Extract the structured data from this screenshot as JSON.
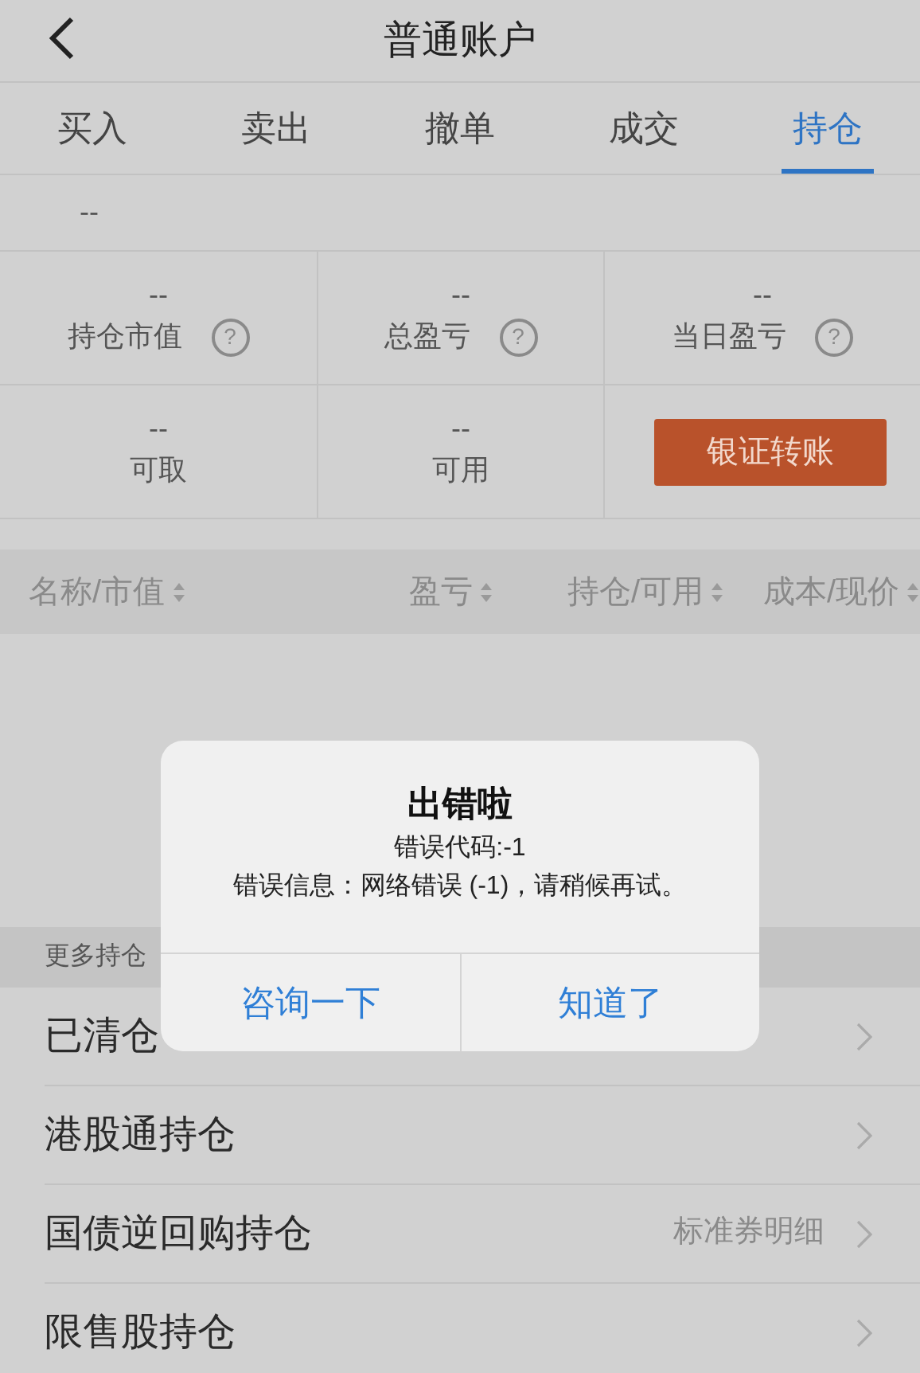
{
  "header": {
    "title": "普通账户"
  },
  "tabs": [
    {
      "label": "买入",
      "selected": false
    },
    {
      "label": "卖出",
      "selected": false
    },
    {
      "label": "撤单",
      "selected": false
    },
    {
      "label": "成交",
      "selected": false
    },
    {
      "label": "持仓",
      "selected": true
    }
  ],
  "account": {
    "value": "--"
  },
  "summary": [
    {
      "value": "--",
      "label": "持仓市值",
      "help": "?"
    },
    {
      "value": "--",
      "label": "总盈亏",
      "help": "?"
    },
    {
      "value": "--",
      "label": "当日盈亏",
      "help": "?"
    }
  ],
  "funds": [
    {
      "value": "--",
      "label": "可取"
    },
    {
      "value": "--",
      "label": "可用"
    }
  ],
  "transfer_button": "银证转账",
  "table": {
    "columns": [
      "名称/市值",
      "盈亏",
      "持仓/可用",
      "成本/现价"
    ]
  },
  "more": {
    "title": "更多持仓",
    "items": [
      {
        "label": "已清仓"
      },
      {
        "label": "港股通持仓"
      },
      {
        "label": "国债逆回购持仓",
        "detail": "标准券明细"
      },
      {
        "label": "限售股持仓"
      }
    ]
  },
  "dialog": {
    "title": "出错啦",
    "lines": [
      "错误代码:-1",
      "错误信息：网络错误 (-1)，请稍候再试。"
    ],
    "buttons": [
      "咨询一下",
      "知道了"
    ]
  }
}
